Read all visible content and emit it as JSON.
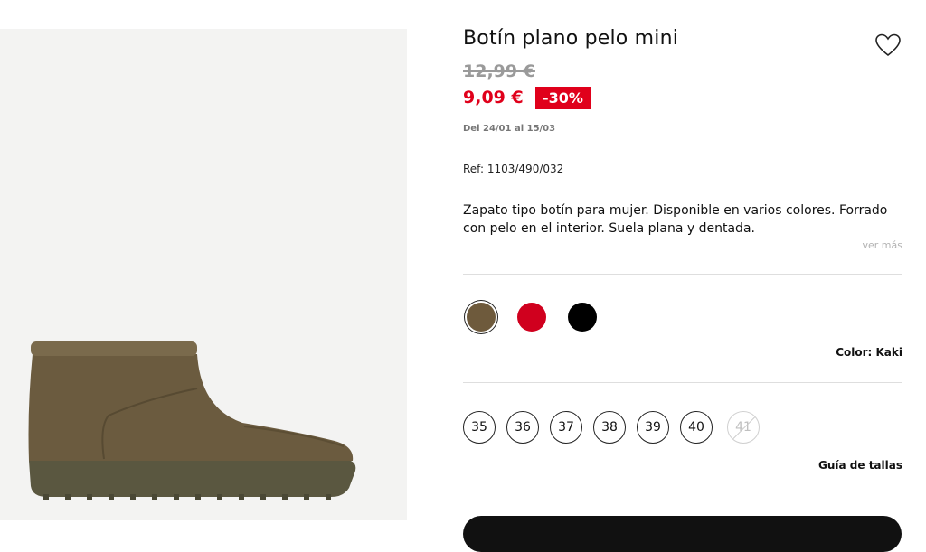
{
  "product": {
    "title": "Botín plano pelo mini",
    "old_price": "12,99 €",
    "new_price": "9,09 €",
    "discount": "-30%",
    "dates": "Del 24/01 al 15/03",
    "ref": "Ref: 1103/490/032",
    "description": "Zapato tipo botín para mujer. Disponible en varios colores. Forrado con pelo en el interior. Suela plana y dentada.",
    "ver_mas": "ver más",
    "image_alt": "boot-image"
  },
  "colors": {
    "options": [
      {
        "name": "kaki",
        "hex": "#6e5a3c",
        "selected": true
      },
      {
        "name": "red",
        "hex": "#d0001e",
        "selected": false
      },
      {
        "name": "black",
        "hex": "#000000",
        "selected": false
      }
    ],
    "label": "Color: Kaki"
  },
  "sizes": {
    "options": [
      {
        "label": "35",
        "available": true
      },
      {
        "label": "36",
        "available": true
      },
      {
        "label": "37",
        "available": true
      },
      {
        "label": "38",
        "available": true
      },
      {
        "label": "39",
        "available": true
      },
      {
        "label": "40",
        "available": true
      },
      {
        "label": "41",
        "available": false
      }
    ],
    "guide": "Guía de tallas"
  },
  "icons": {
    "wishlist": "heart-outline-icon"
  },
  "theme": {
    "accent": "#e0001b",
    "text": "#111111",
    "muted": "#9a9a9a",
    "image_bg": "#f3f3f2",
    "boot_color": "#6b5b3f",
    "sole_color": "#5a5740"
  }
}
